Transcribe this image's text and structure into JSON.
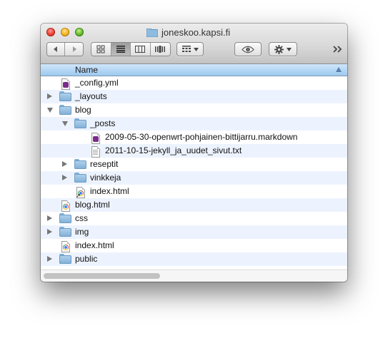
{
  "window": {
    "title": "joneskoo.kapsi.fi",
    "title_icon": "folder-icon"
  },
  "toolbar": {
    "back_icon": "back-arrow-icon",
    "forward_icon": "forward-arrow-icon",
    "view_modes": [
      "icon-view",
      "list-view",
      "column-view",
      "cover-flow-view"
    ],
    "active_view": "list-view",
    "arrange_icon": "arrange-grid-icon",
    "quicklook_icon": "eye-icon",
    "action_icon": "gear-icon"
  },
  "columns": {
    "name": "Name",
    "sort": "ascending"
  },
  "items": [
    {
      "name": "_config.yml",
      "kind": "file",
      "indent": 0,
      "disclosure": "none",
      "icon": "text-file-icon"
    },
    {
      "name": "_layouts",
      "kind": "folder",
      "indent": 0,
      "disclosure": "closed",
      "icon": "folder-icon"
    },
    {
      "name": "blog",
      "kind": "folder",
      "indent": 0,
      "disclosure": "open",
      "icon": "folder-icon"
    },
    {
      "name": "_posts",
      "kind": "folder",
      "indent": 1,
      "disclosure": "open",
      "icon": "folder-icon"
    },
    {
      "name": "2009-05-30-openwrt-pohjainen-bittijarru.markdown",
      "kind": "file",
      "indent": 2,
      "disclosure": "none",
      "icon": "markdown-file-icon"
    },
    {
      "name": "2011-10-15-jekyll_ja_uudet_sivut.txt",
      "kind": "file",
      "indent": 2,
      "disclosure": "none",
      "icon": "text-file-icon"
    },
    {
      "name": "reseptit",
      "kind": "folder",
      "indent": 1,
      "disclosure": "closed",
      "icon": "folder-icon"
    },
    {
      "name": "vinkkeja",
      "kind": "folder",
      "indent": 1,
      "disclosure": "closed",
      "icon": "folder-icon"
    },
    {
      "name": "index.html",
      "kind": "alias",
      "indent": 1,
      "disclosure": "none",
      "icon": "html-alias-icon"
    },
    {
      "name": "blog.html",
      "kind": "file",
      "indent": 0,
      "disclosure": "none",
      "icon": "html-file-icon"
    },
    {
      "name": "css",
      "kind": "folder",
      "indent": 0,
      "disclosure": "closed",
      "icon": "folder-icon"
    },
    {
      "name": "img",
      "kind": "folder",
      "indent": 0,
      "disclosure": "closed",
      "icon": "folder-icon"
    },
    {
      "name": "index.html",
      "kind": "file",
      "indent": 0,
      "disclosure": "none",
      "icon": "html-file-icon"
    },
    {
      "name": "public",
      "kind": "folder",
      "indent": 0,
      "disclosure": "closed",
      "icon": "folder-icon"
    }
  ]
}
